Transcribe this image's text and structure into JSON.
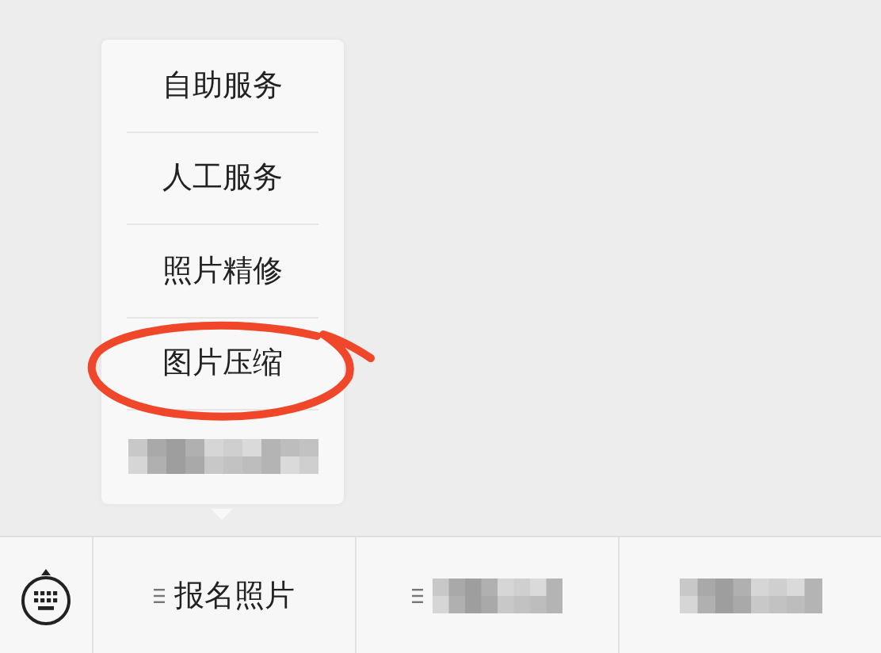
{
  "menu": {
    "items": [
      {
        "kind": "text",
        "label": "自助服务"
      },
      {
        "kind": "text",
        "label": "人工服务"
      },
      {
        "kind": "text",
        "label": "照片精修"
      },
      {
        "kind": "text",
        "label": "图片压缩"
      },
      {
        "kind": "blurred"
      }
    ]
  },
  "bottom_bar": {
    "tabs": [
      {
        "kind": "text",
        "label": "报名照片"
      },
      {
        "kind": "blurred"
      },
      {
        "kind": "blurred"
      }
    ]
  }
}
